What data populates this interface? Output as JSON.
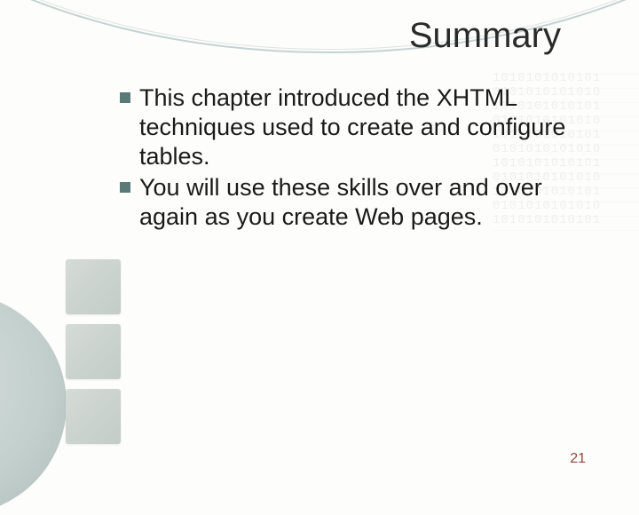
{
  "title": "Summary",
  "bullets": [
    "This chapter introduced the XHTML techniques used to create and configure tables.",
    "You will use these skills over and over again as you create Web pages."
  ],
  "page_number": "21",
  "bg_digits": "1010101010101\n0101010101010\n1010101010101\n0101010101010\n1010101010101\n0101010101010\n1010101010101\n0101010101010\n1010101010101\n0101010101010\n1010101010101"
}
